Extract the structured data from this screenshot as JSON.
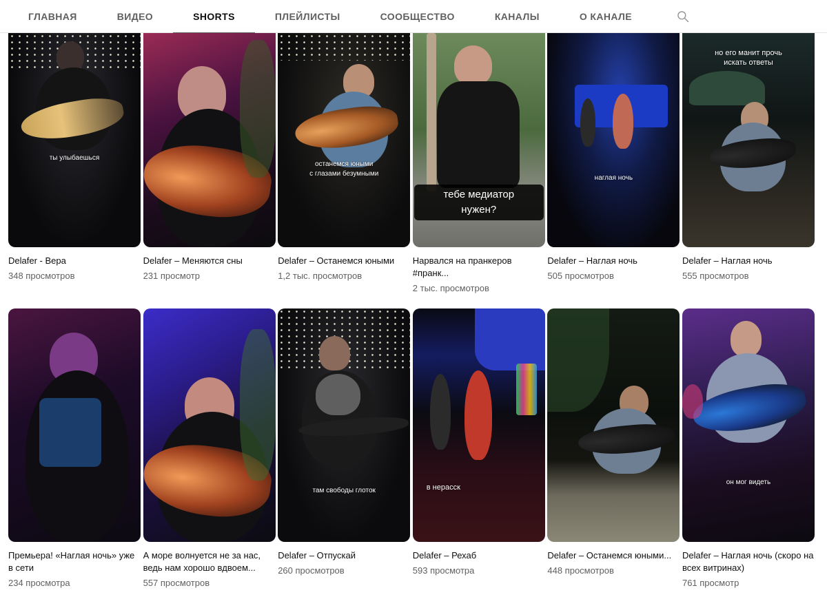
{
  "tabs": [
    {
      "label": "ГЛАВНАЯ"
    },
    {
      "label": "ВИДЕО"
    },
    {
      "label": "SHORTS"
    },
    {
      "label": "ПЛЕЙЛИСТЫ"
    },
    {
      "label": "СООБЩЕСТВО"
    },
    {
      "label": "КАНАЛЫ"
    },
    {
      "label": "О КАНАЛЕ"
    }
  ],
  "active_tab": "SHORTS",
  "search_icon": "search-icon",
  "shorts": [
    {
      "title": "Delafer - Вера",
      "views": "348 просмотров",
      "caption": "ты улыбаешься"
    },
    {
      "title": "Delafer – Меняются сны",
      "views": "231 просмотр",
      "caption": ""
    },
    {
      "title": "Delafer – Останемся юными",
      "views": "1,2 тыс. просмотров",
      "caption": "останемся юными\nс глазами безумными"
    },
    {
      "title": "Нарвался на пранкеров #пранк...",
      "views": "2 тыс. просмотров",
      "caption": "тебе медиатор\nнужен?"
    },
    {
      "title": "Delafer – Наглая ночь",
      "views": "505 просмотров",
      "caption": "наглая ночь"
    },
    {
      "title": "Delafer – Наглая ночь",
      "views": "555 просмотров",
      "caption": "но его манит прочь\nискать ответы"
    },
    {
      "title": "Премьера! «Наглая ночь» уже в сети",
      "views": "234 просмотра",
      "caption": ""
    },
    {
      "title": "А море волнуется не за нас, ведь нам хорошо вдвоем...",
      "views": "557 просмотров",
      "caption": ""
    },
    {
      "title": "Delafer – Отпускай",
      "views": "260 просмотров",
      "caption": "там свободы глоток"
    },
    {
      "title": "Delafer – Рехаб",
      "views": "593 просмотра",
      "caption": "в нерасск"
    },
    {
      "title": "Delafer – Останемся юными...",
      "views": "448 просмотров",
      "caption": ""
    },
    {
      "title": "Delafer – Наглая ночь (скоро на всех витринах)",
      "views": "761 просмотр",
      "caption": "он мог видеть"
    }
  ],
  "colors": {
    "active_underline": "#606060",
    "tab_text": "#606060",
    "meta_text": "#606060"
  }
}
